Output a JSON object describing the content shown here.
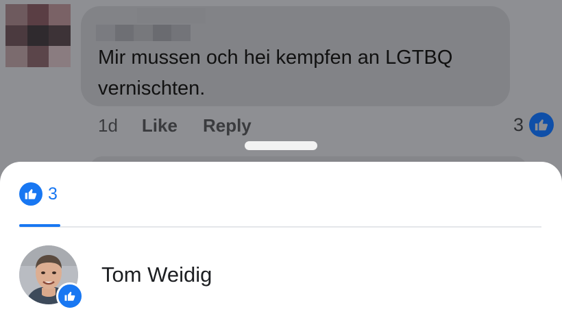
{
  "comment": {
    "text": "Mir mussen och hei kempfen an LGTBQ vernischten.",
    "time": "1d",
    "like_label": "Like",
    "reply_label": "Reply",
    "reaction_count": "3"
  },
  "reactions_sheet": {
    "tab_count": "3",
    "users": [
      {
        "name": "Tom Weidig",
        "reaction": "like-icon"
      }
    ]
  },
  "colors": {
    "brand_blue": "#1877f2",
    "overlay": "#8e8f93",
    "sheet_bg": "#ffffff"
  }
}
